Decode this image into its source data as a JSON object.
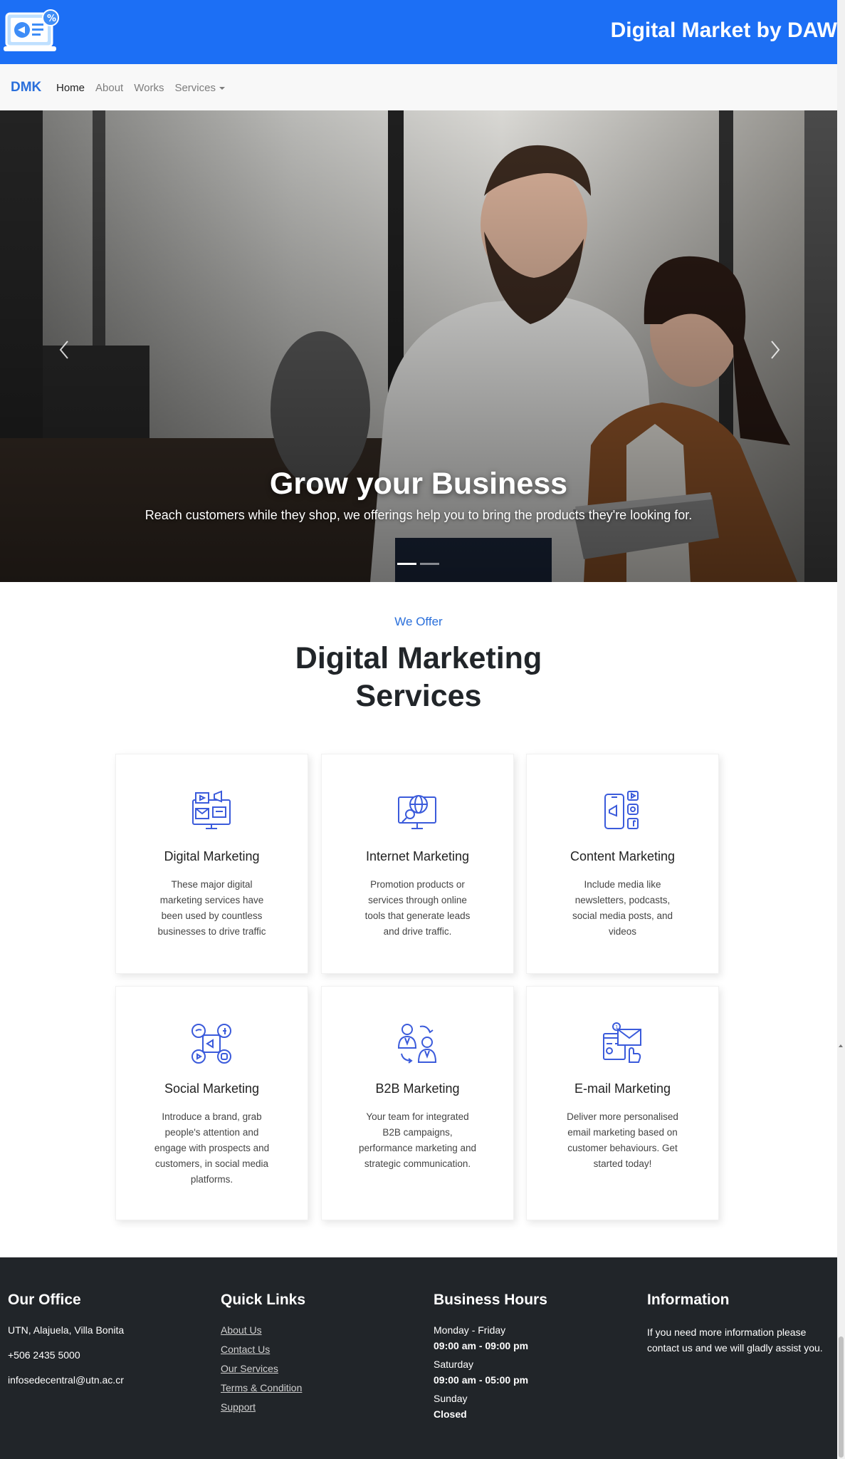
{
  "header": {
    "title": "Digital Market by DAW",
    "logo_icon": "marketing-laptop-logo",
    "accent": "#1c6ff5"
  },
  "nav": {
    "brand": "DMK",
    "items": [
      {
        "label": "Home",
        "active": true
      },
      {
        "label": "About"
      },
      {
        "label": "Works"
      },
      {
        "label": "Services",
        "dropdown": true
      }
    ]
  },
  "hero": {
    "title": "Grow your Business",
    "subtitle": "Reach customers while they shop, we offerings help you to bring the products they're looking for.",
    "slides": 2,
    "active_slide": 1
  },
  "services": {
    "eyebrow": "We Offer",
    "title_line1": "Digital Marketing",
    "title_line2": "Services",
    "items": [
      {
        "title": "Digital Marketing",
        "text": "These major digital marketing services have been used by countless businesses to drive traffic",
        "icon": "digital-marketing-icon"
      },
      {
        "title": "Internet Marketing",
        "text": "Promotion products or services through online tools that generate leads and drive traffic.",
        "icon": "internet-marketing-icon"
      },
      {
        "title": "Content Marketing",
        "text": "Include media like newsletters, podcasts, social media posts, and videos",
        "icon": "content-marketing-icon"
      },
      {
        "title": "Social Marketing",
        "text": "Introduce a brand, grab people's attention and engage with prospects and customers, in social media platforms.",
        "icon": "social-marketing-icon"
      },
      {
        "title": "B2B Marketing",
        "text": "Your team for integrated B2B campaigns, performance marketing and strategic communication.",
        "icon": "b2b-marketing-icon"
      },
      {
        "title": "E-mail Marketing",
        "text": "Deliver more personalised email marketing based on customer behaviours. Get started today!",
        "icon": "email-marketing-icon"
      }
    ]
  },
  "footer": {
    "office": {
      "title": "Our Office",
      "address": "UTN, Alajuela, Villa Bonita",
      "phone": "+506 2435 5000",
      "email": "infosedecentral@utn.ac.cr"
    },
    "links": {
      "title": "Quick Links",
      "items": [
        "About Us",
        "Contact Us",
        "Our Services",
        "Terms & Condition",
        "Support"
      ]
    },
    "hours": {
      "title": "Business Hours",
      "rows": [
        {
          "day": "Monday - Friday",
          "time": "09:00 am - 09:00 pm"
        },
        {
          "day": "Saturday",
          "time": "09:00 am - 05:00 pm"
        },
        {
          "day": "Sunday",
          "time": "Closed"
        }
      ]
    },
    "info": {
      "title": "Information",
      "text": "If you need more information please contact us and we will gladly assist you."
    }
  }
}
